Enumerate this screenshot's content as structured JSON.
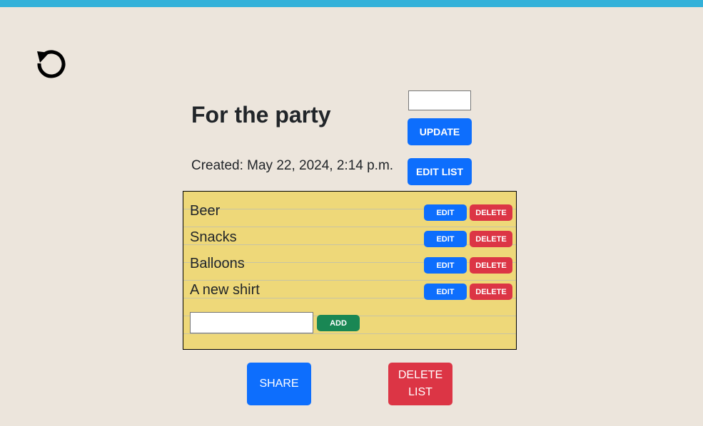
{
  "list": {
    "title": "For the party",
    "title_input_value": "",
    "update_label": "UPDATE",
    "created": "Created: May 22, 2024, 2:14 p.m.",
    "edit_list_label": "EDIT LIST"
  },
  "items": [
    {
      "label": "Beer",
      "edit_label": "EDIT",
      "delete_label": "DELETE"
    },
    {
      "label": "Snacks",
      "edit_label": "EDIT",
      "delete_label": "DELETE"
    },
    {
      "label": "Balloons",
      "edit_label": "EDIT",
      "delete_label": "DELETE"
    },
    {
      "label": "A new shirt",
      "edit_label": "EDIT",
      "delete_label": "DELETE"
    }
  ],
  "add_item": {
    "input_value": "",
    "add_label": "ADD"
  },
  "footer": {
    "share_label": "SHARE",
    "delete_list_label": "DELETE LIST"
  },
  "icons": {
    "back": "rotate-ccw-icon"
  },
  "colors": {
    "top_bar": "#33b1d9",
    "background": "#ece5dc",
    "notepad": "#eed879",
    "primary": "#0d6efd",
    "danger": "#dc3545",
    "success": "#198754"
  }
}
